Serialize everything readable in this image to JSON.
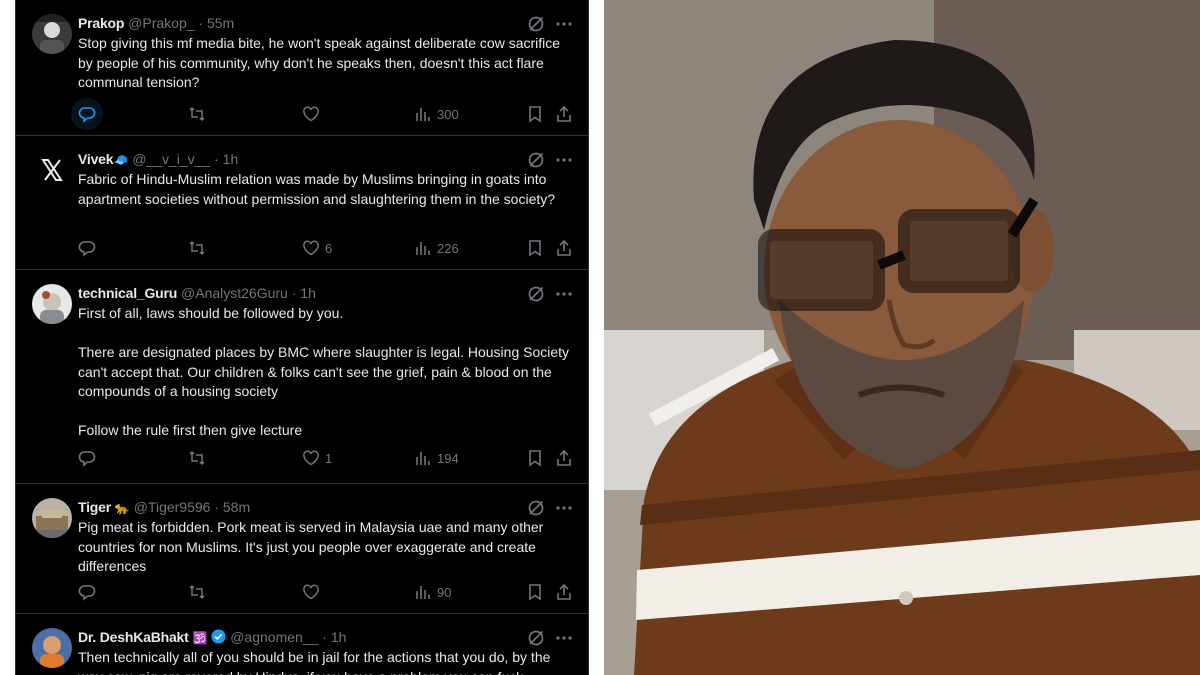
{
  "tweets": [
    {
      "name": "Prakop",
      "handle": "@Prakop_",
      "time": "· 55m",
      "lines": [
        "Stop giving this mf media bite, he won't speak against deliberate cow sacrifice by people of his community, why don't he speaks then, doesn't this act flare communal tension?"
      ],
      "likes": "",
      "views": "300",
      "avatar_icon": "avatar-photo"
    },
    {
      "name": "Vivek",
      "name_emoji": "🧢",
      "handle": "@__v_i_v__",
      "time": "· 1h",
      "lines": [
        "Fabric of Hindu-Muslim relation was made by Muslims bringing in goats into apartment societies without permission and slaughtering them in the society?"
      ],
      "likes": "6",
      "views": "226",
      "avatar_icon": "x-logo-icon"
    },
    {
      "name": "technical_Guru",
      "handle": "@Analyst26Guru",
      "time": "· 1h",
      "lines": [
        "First of all, laws should be followed by you.",
        "There are designated places by BMC where slaughter is legal. Housing Society can't accept that. Our children & folks can't see the grief, pain & blood on the compounds of a housing society",
        "Follow the rule first then give lecture"
      ],
      "likes": "1",
      "views": "194",
      "avatar_icon": "avatar-photo"
    },
    {
      "name": "Tiger",
      "name_emoji": "🐆",
      "handle": "@Tiger9596",
      "time": "· 58m",
      "lines": [
        "Pig meat is forbidden. Pork meat is served in Malaysia uae and many other countries for non Muslims. It's just you people over exaggerate and create differences"
      ],
      "likes": "",
      "views": "90",
      "avatar_icon": "avatar-photo"
    },
    {
      "name": "Dr. DeshKaBhakt",
      "name_emoji": "🕉️",
      "handle": "@agnomen__",
      "time": "· 1h",
      "lines": [
        "Then technically all of you should be in jail for the actions that you do, by the way cow, pig are revered by Hindus, if you have a problem you can fuck"
      ],
      "likes": "",
      "views": "",
      "avatar_icon": "avatar-photo"
    }
  ],
  "colors": {
    "feed_bg": "#000000",
    "text": "#e7e9ea",
    "muted": "#71767b",
    "divider": "#2f3336",
    "verified": "#1d9bf0",
    "shirt_brown": "#6e3a1c"
  }
}
